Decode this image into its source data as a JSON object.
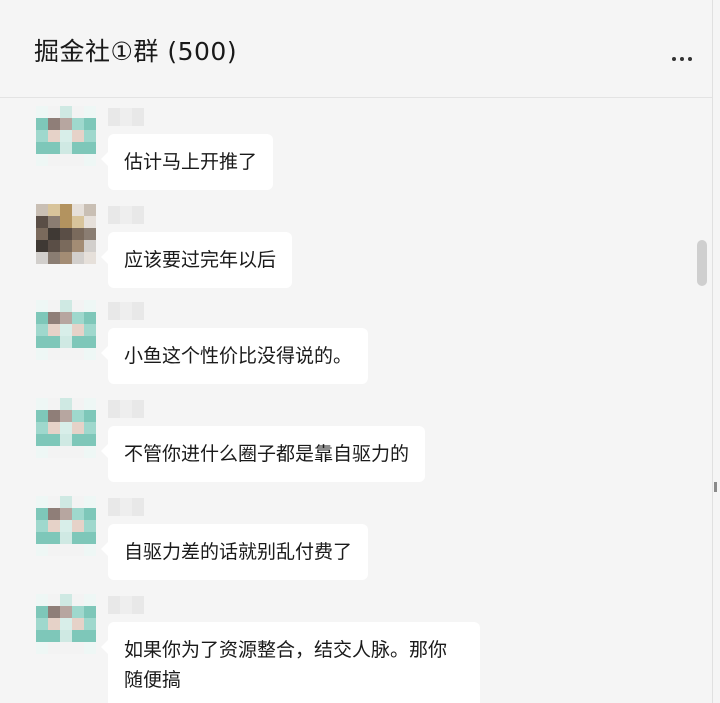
{
  "header": {
    "title": "掘金社①群 (500)",
    "more_icon": "more-horizontal-icon"
  },
  "messages": [
    {
      "text": "估计马上开推了",
      "avatar": "avatar-teal"
    },
    {
      "text": "应该要过完年以后",
      "avatar": "avatar-brown"
    },
    {
      "text": "小鱼这个性价比没得说的。",
      "avatar": "avatar-teal"
    },
    {
      "text": "不管你进什么圈子都是靠自驱力的",
      "avatar": "avatar-teal"
    },
    {
      "text": "自驱力差的话就别乱付费了",
      "avatar": "avatar-teal"
    },
    {
      "text": "如果你为了资源整合，结交人脉。那你随便搞",
      "avatar": "avatar-teal"
    }
  ],
  "colors": {
    "background": "#f5f5f5",
    "bubble": "#ffffff",
    "teal": "#8fd3c7"
  }
}
